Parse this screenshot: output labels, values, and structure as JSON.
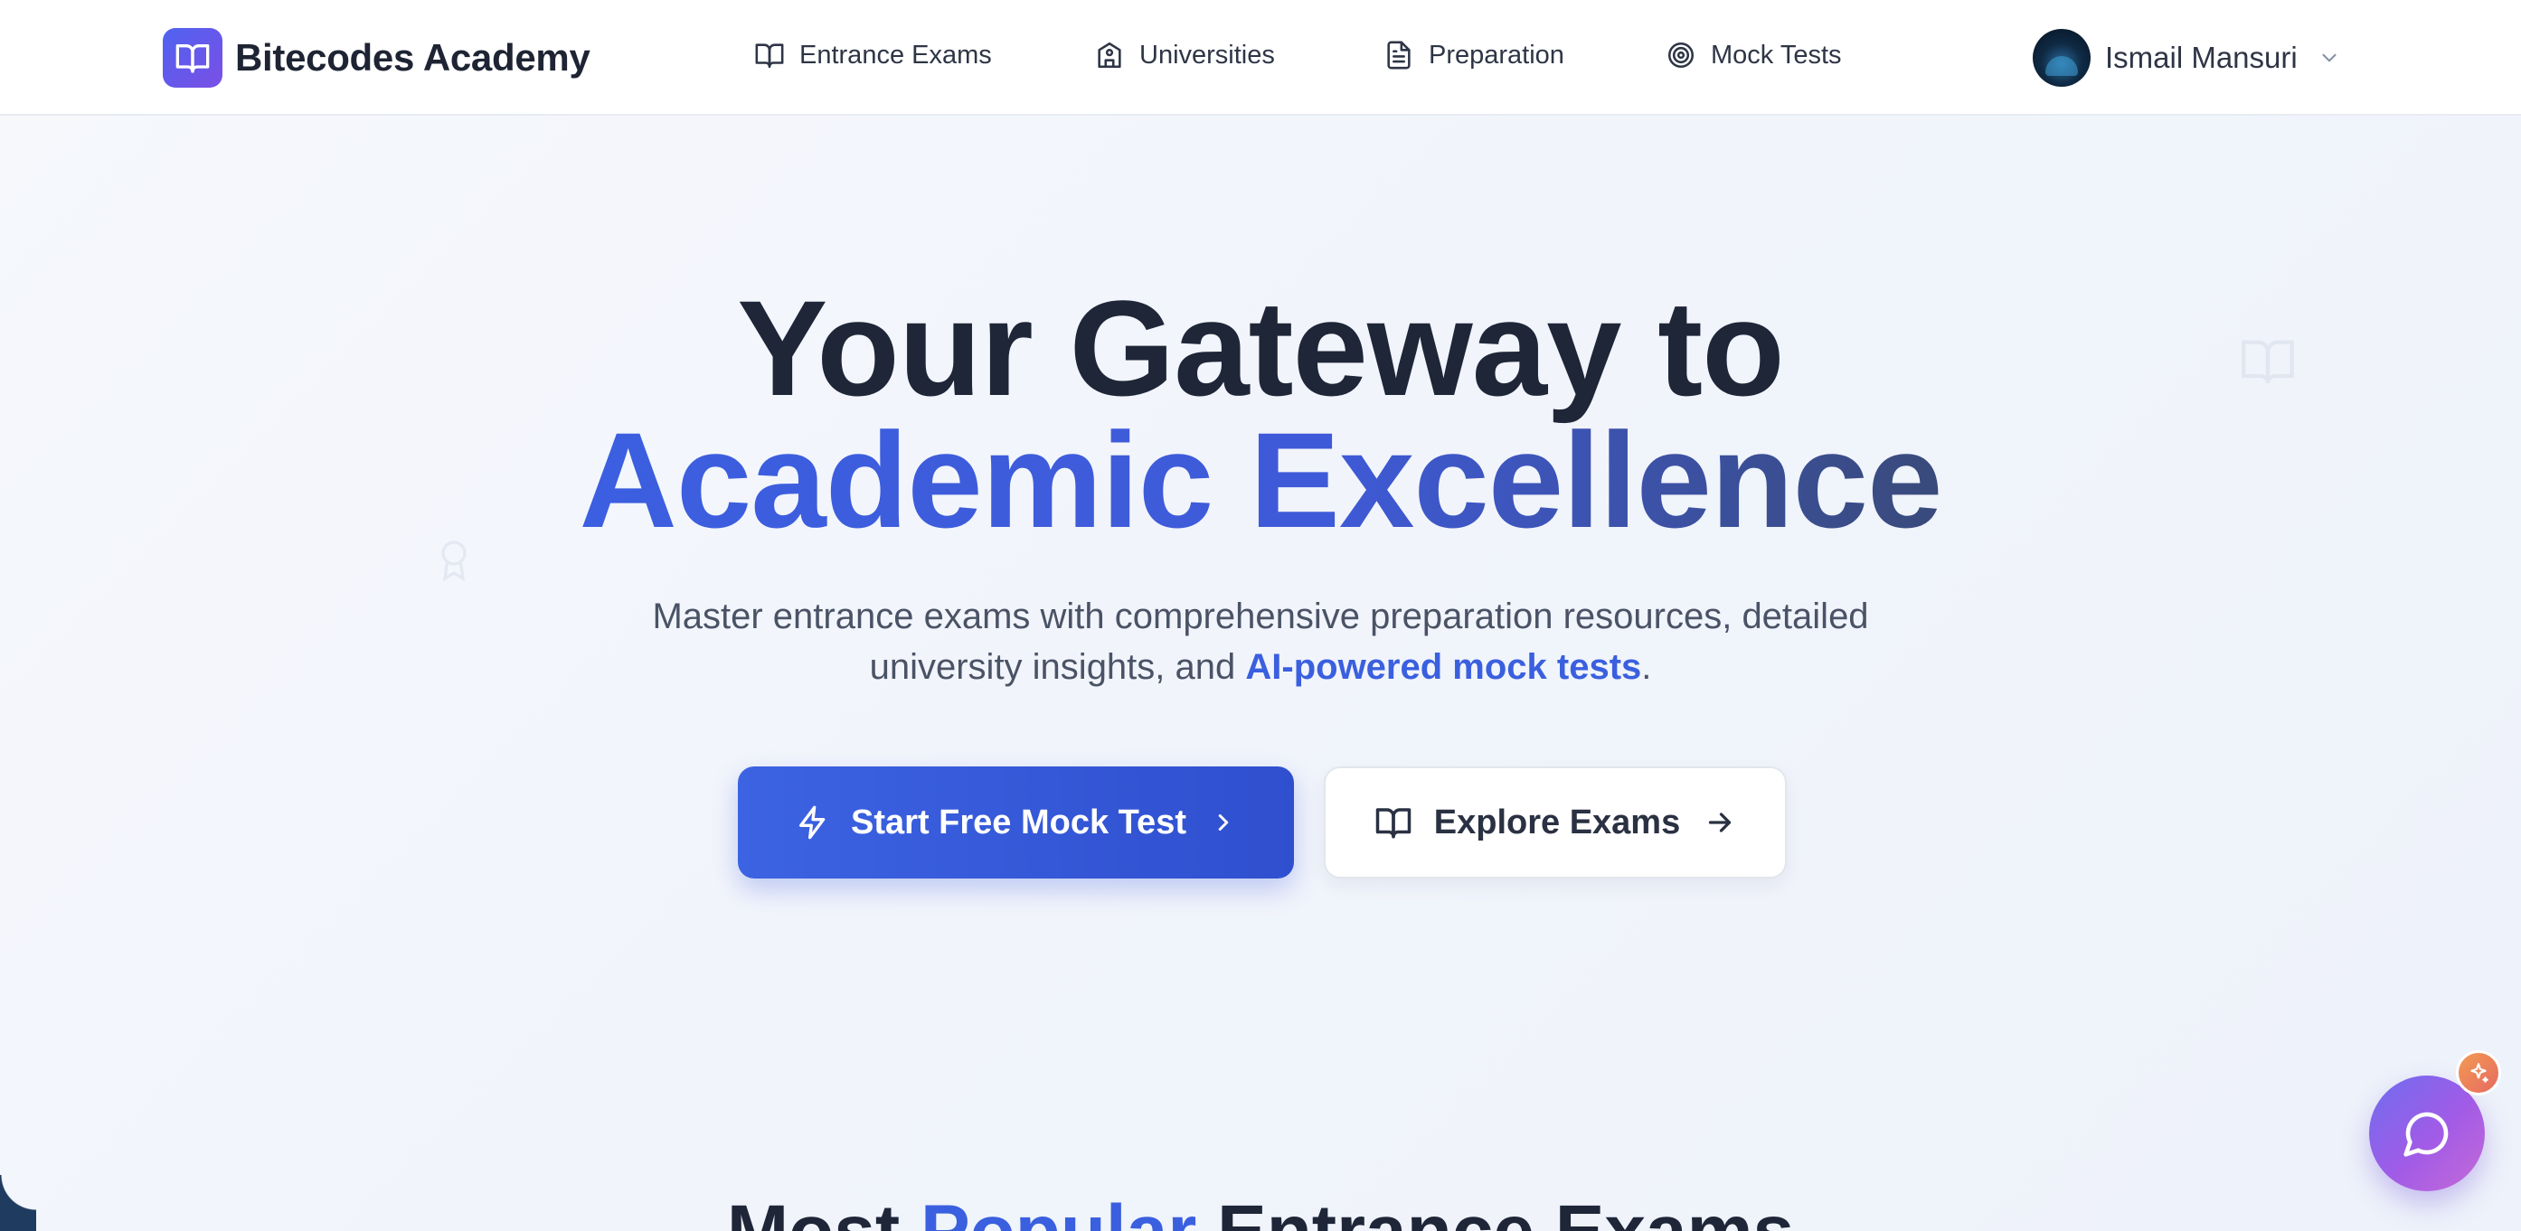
{
  "brand": {
    "name": "Bitecodes Academy",
    "logo_icon": "book-open-icon",
    "logo_color": "#5b5bf0"
  },
  "nav": {
    "items": [
      {
        "label": "Entrance Exams",
        "icon": "book-open-icon"
      },
      {
        "label": "Universities",
        "icon": "school-building-icon"
      },
      {
        "label": "Preparation",
        "icon": "document-icon"
      },
      {
        "label": "Mock Tests",
        "icon": "target-icon"
      }
    ]
  },
  "user": {
    "name": "Ismail Mansuri",
    "menu_icon": "chevron-down-icon"
  },
  "hero": {
    "title_line1": "Your Gateway to",
    "title_line2": "Academic Excellence",
    "subtitle_line1": "Master entrance exams with comprehensive preparation resources, detailed",
    "subtitle_line2_prefix": "university insights, and ",
    "subtitle_highlight": "AI-powered mock tests",
    "subtitle_suffix": ".",
    "accent_color": "#3a5fdf"
  },
  "buttons": {
    "primary": {
      "label": "Start Free Mock Test",
      "icon": "lightning-icon",
      "trail_icon": "chevron-right-icon"
    },
    "secondary": {
      "label": "Explore Exams",
      "icon": "book-open-icon",
      "trail_icon": "arrow-right-icon"
    }
  },
  "section": {
    "title_prefix": "Most ",
    "title_highlight": "Popular",
    "title_suffix": " Entrance Exams"
  },
  "chat": {
    "icon": "chat-bubble-icon",
    "badge_icon": "sparkle-icon"
  }
}
